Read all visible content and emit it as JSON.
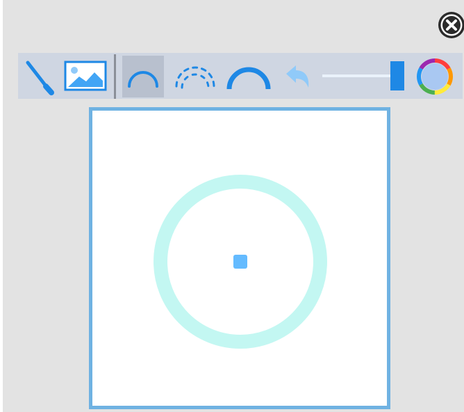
{
  "toolbar": {
    "tools": [
      {
        "id": "pen",
        "icon": "pen-icon",
        "selected": false
      },
      {
        "id": "image",
        "icon": "image-icon",
        "selected": false
      },
      {
        "id": "arc",
        "icon": "arc-icon",
        "selected": true
      },
      {
        "id": "dashed-arc",
        "icon": "dashed-arc-icon",
        "selected": false
      },
      {
        "id": "thick-arc",
        "icon": "thick-arc-icon",
        "selected": false
      },
      {
        "id": "undo",
        "icon": "undo-icon",
        "selected": false
      },
      {
        "id": "size-slider",
        "icon": "slider",
        "selected": false,
        "value": 1.0
      },
      {
        "id": "color-picker",
        "icon": "color-wheel-icon",
        "selected": false
      }
    ]
  },
  "colors": {
    "accent": "#1e88e5",
    "canvas_border": "#6fb2e2",
    "ring": "#c3f7f2",
    "center_dot": "#64bbff",
    "current_color": "#a9c8f2"
  }
}
